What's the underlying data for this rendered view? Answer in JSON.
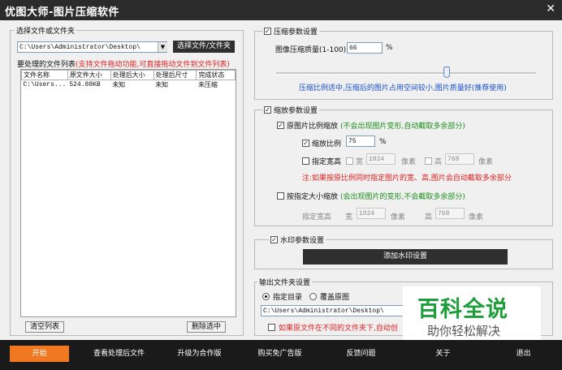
{
  "window": {
    "title": "优图大师-图片压缩软件",
    "close_glyph": "✕"
  },
  "left_panel": {
    "group_label": "选择文件或文件夹",
    "path_value": "C:\\Users\\Administrator\\Desktop\\",
    "select_button": "选择文件/文件夹",
    "list_label": "要处理的文件列表",
    "list_hint": "(支持文件拖动功能,可直接拖动文件到文件列表)",
    "columns": [
      "文件名称",
      "原文件大小",
      "处理后大小",
      "处理后尺寸",
      "完成状态"
    ],
    "rows": [
      [
        "C:\\Users...",
        "524.88KB",
        "未知",
        "未知",
        "未压缩"
      ]
    ],
    "clear_button": "清空列表",
    "delete_button": "删除选中"
  },
  "compression": {
    "group_label": "压缩参数设置",
    "quality_label": "图像压缩质量(1-100):",
    "quality_value": "66",
    "quality_unit": "%",
    "slider_value_percent": 66,
    "hint": "压缩比例适中,压缩后的图片占用空间较小,图片质量好(推荐使用)"
  },
  "scale": {
    "group_label": "缩放参数设置",
    "ratio_mode_label": "原图片比例缩放",
    "ratio_mode_hint": "(不会出现图片变形,自动截取多余部分)",
    "ratio_label": "缩放比例",
    "ratio_value": "75",
    "ratio_unit": "%",
    "fixed_size_label": "指定宽高",
    "width_label": "宽",
    "width_value": "1024",
    "pixel_unit": "像素",
    "height_label": "高",
    "height_value": "768",
    "note": "注:如果按原比例同时指定图片的宽、高,图片会自动截取多余部分",
    "size_mode_label": "按指定大小缩放",
    "size_mode_hint": "(会出现图片的变形,不会截取多余部分)",
    "size_label": "指定宽高",
    "size_width_label": "宽",
    "size_width_value": "1024",
    "size_height_label": "高",
    "size_height_value": "768"
  },
  "watermark": {
    "group_label": "水印参数设置",
    "add_button": "添加水印设置"
  },
  "output": {
    "group_label": "输出文件夹设置",
    "option_dir": "指定目录",
    "option_overwrite": "覆盖原图",
    "path_value": "C:\\Users\\Administrator\\Desktop\\",
    "keep_structure_label": "如果原文件在不同的文件夹下,自动创"
  },
  "overlay": {
    "brand_main": "百科全说",
    "brand_sub": "助你轻松解决"
  },
  "bottom_bar": {
    "buttons": [
      "开始",
      "查看处理后文件",
      "升级为合作版",
      "购买免广告版",
      "反馈问题",
      "关于",
      "退出"
    ]
  },
  "colors": {
    "accent_orange": "#f07820",
    "title_bar": "#2b2b2b",
    "hint_red": "#e02020",
    "hint_green": "#1a8f1a",
    "hint_blue": "#1850c8",
    "brand_green": "#1e9e3a"
  }
}
